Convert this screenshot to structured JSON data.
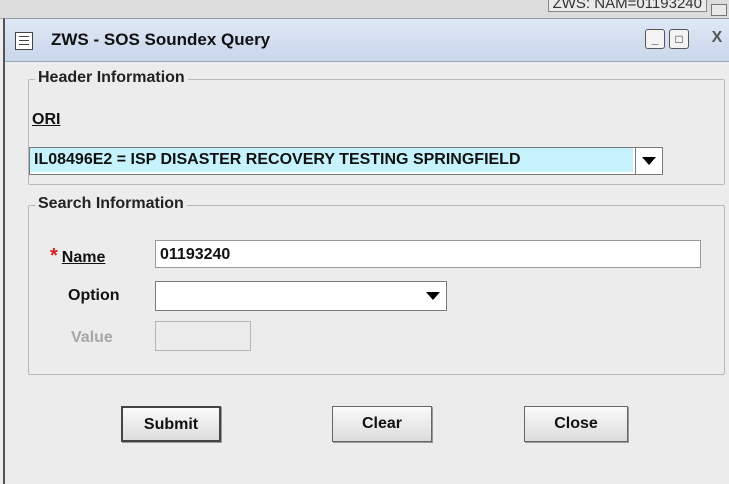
{
  "background_window": {
    "title": "ZWS: NAM=01193240"
  },
  "window": {
    "title": "ZWS - SOS Soundex Query",
    "controls": {
      "minimize": "_",
      "maximize": "□",
      "close": "X"
    }
  },
  "header_info": {
    "title": "Header Information",
    "ori_label": "ORI",
    "ori_value": "IL08496E2 = ISP DISASTER RECOVERY TESTING    SPRINGFIELD"
  },
  "search_info": {
    "title": "Search Information",
    "name_required_mark": "*",
    "name_label": "Name",
    "name_value": "01193240",
    "option_label": "Option",
    "option_value": "",
    "value_label": "Value",
    "value_value": ""
  },
  "buttons": {
    "submit": "Submit",
    "clear": "Clear",
    "close": "Close"
  },
  "colors": {
    "ori_highlight": "#c6f3fb",
    "required": "#d32020"
  }
}
